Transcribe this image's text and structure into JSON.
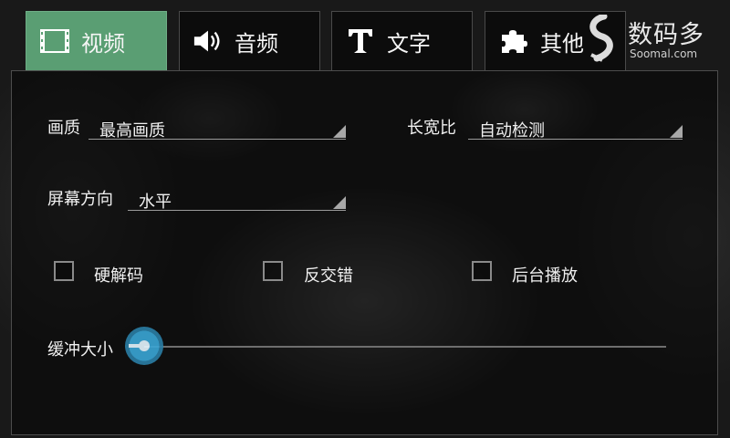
{
  "tabs": [
    {
      "label": "视频",
      "icon": "film-icon",
      "active": true
    },
    {
      "label": "音频",
      "icon": "speaker-icon",
      "active": false
    },
    {
      "label": "文字",
      "icon": "text-t-icon",
      "active": false
    },
    {
      "label": "其他",
      "icon": "puzzle-icon",
      "active": false
    }
  ],
  "watermark": {
    "title": "数码多",
    "subtitle": "Soomal.com"
  },
  "settings": {
    "quality": {
      "label": "画质",
      "value": "最高画质"
    },
    "aspect": {
      "label": "长宽比",
      "value": "自动检测"
    },
    "orientation": {
      "label": "屏幕方向",
      "value": "水平"
    },
    "hw_decode": {
      "label": "硬解码",
      "checked": false
    },
    "deinterlace": {
      "label": "反交错",
      "checked": false
    },
    "background_play": {
      "label": "后台播放",
      "checked": false
    },
    "buffer": {
      "label": "缓冲大小",
      "level": 0.0
    }
  },
  "colors": {
    "active_tab": "#5a9e73",
    "slider_accent": "#3aa6d6"
  }
}
